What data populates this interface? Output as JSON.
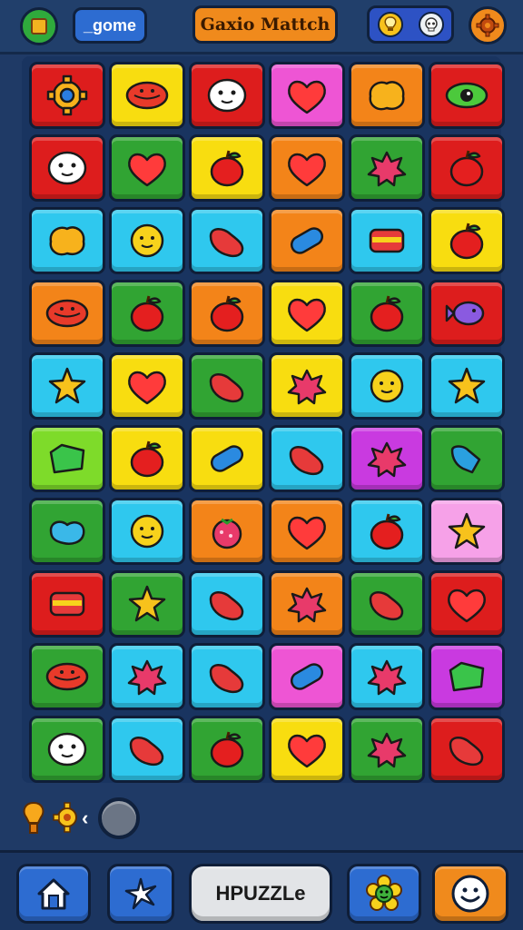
{
  "header": {
    "home_label": "_gome",
    "title": "Gaxio Mattch",
    "settings_icon": "gear-icon",
    "hint_icon": "lightbulb-icon",
    "skull_icon": "skull-icon"
  },
  "colors": {
    "R": "#dd1d1d",
    "Y": "#f8dd10",
    "P": "#ee55d4",
    "O": "#f38419",
    "G": "#31a433",
    "C": "#2fc8ee",
    "L": "#7edb2a",
    "M": "#c93ae0",
    "K": "#f6a1e8"
  },
  "grid": [
    [
      {
        "c": "R",
        "i": "gear"
      },
      {
        "c": "Y",
        "i": "candy"
      },
      {
        "c": "R",
        "i": "face"
      },
      {
        "c": "P",
        "i": "heart"
      },
      {
        "c": "O",
        "i": "blob"
      },
      {
        "c": "R",
        "i": "eye"
      }
    ],
    [
      {
        "c": "R",
        "i": "face"
      },
      {
        "c": "G",
        "i": "heart"
      },
      {
        "c": "Y",
        "i": "apple"
      },
      {
        "c": "O",
        "i": "heart"
      },
      {
        "c": "G",
        "i": "splat"
      },
      {
        "c": "R",
        "i": "apple"
      }
    ],
    [
      {
        "c": "C",
        "i": "blob"
      },
      {
        "c": "C",
        "i": "sun"
      },
      {
        "c": "C",
        "i": "bean"
      },
      {
        "c": "O",
        "i": "tube"
      },
      {
        "c": "C",
        "i": "block"
      },
      {
        "c": "Y",
        "i": "apple"
      }
    ],
    [
      {
        "c": "O",
        "i": "candy"
      },
      {
        "c": "G",
        "i": "apple"
      },
      {
        "c": "O",
        "i": "apple"
      },
      {
        "c": "Y",
        "i": "heart"
      },
      {
        "c": "G",
        "i": "apple"
      },
      {
        "c": "R",
        "i": "fish"
      }
    ],
    [
      {
        "c": "C",
        "i": "star"
      },
      {
        "c": "Y",
        "i": "heart"
      },
      {
        "c": "G",
        "i": "bean"
      },
      {
        "c": "Y",
        "i": "splat"
      },
      {
        "c": "C",
        "i": "sun"
      },
      {
        "c": "C",
        "i": "star"
      }
    ],
    [
      {
        "c": "L",
        "i": "gem"
      },
      {
        "c": "Y",
        "i": "apple"
      },
      {
        "c": "Y",
        "i": "tube"
      },
      {
        "c": "C",
        "i": "bean"
      },
      {
        "c": "M",
        "i": "splat"
      },
      {
        "c": "G",
        "i": "bell"
      }
    ],
    [
      {
        "c": "G",
        "i": "drop"
      },
      {
        "c": "C",
        "i": "sun"
      },
      {
        "c": "O",
        "i": "berry"
      },
      {
        "c": "O",
        "i": "heart"
      },
      {
        "c": "C",
        "i": "apple"
      },
      {
        "c": "K",
        "i": "star"
      }
    ],
    [
      {
        "c": "R",
        "i": "block"
      },
      {
        "c": "G",
        "i": "star"
      },
      {
        "c": "C",
        "i": "bean"
      },
      {
        "c": "O",
        "i": "splat"
      },
      {
        "c": "G",
        "i": "bean"
      },
      {
        "c": "R",
        "i": "heart"
      }
    ],
    [
      {
        "c": "G",
        "i": "candy"
      },
      {
        "c": "C",
        "i": "splat"
      },
      {
        "c": "C",
        "i": "bean"
      },
      {
        "c": "P",
        "i": "tube"
      },
      {
        "c": "C",
        "i": "splat"
      },
      {
        "c": "M",
        "i": "gem"
      }
    ],
    [
      {
        "c": "G",
        "i": "face"
      },
      {
        "c": "C",
        "i": "bean"
      },
      {
        "c": "G",
        "i": "apple"
      },
      {
        "c": "Y",
        "i": "heart"
      },
      {
        "c": "G",
        "i": "splat"
      },
      {
        "c": "R",
        "i": "bean"
      }
    ]
  ],
  "boosters": {
    "items": [
      "lightbulb-icon",
      "gear-icon"
    ],
    "arrow": "‹"
  },
  "bottom_bar": {
    "home_icon": "house-icon",
    "star_icon": "star-icon",
    "puzzle_label": "HPUZZLe",
    "flower_icon": "flower-icon",
    "smile_icon": "smile-icon"
  }
}
